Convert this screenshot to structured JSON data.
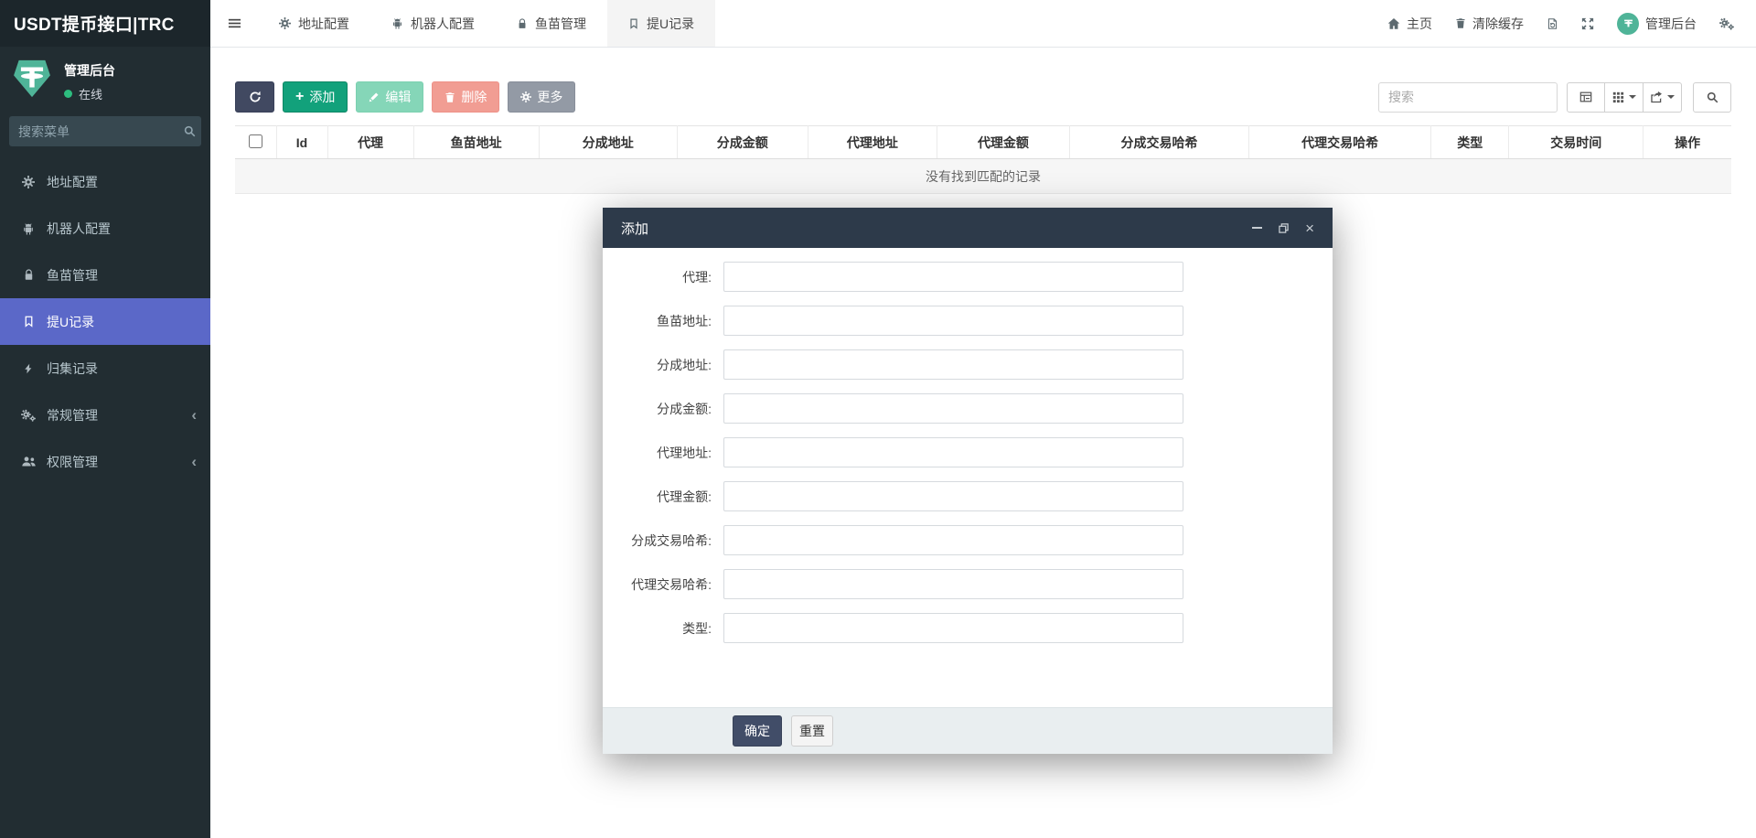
{
  "app": {
    "title": "USDT提币接口|TRC"
  },
  "colors": {
    "sidebar_bg": "#222d32",
    "active_item_blue": "#5b68c8",
    "tether_green": "#4fb498",
    "add_button_green": "#12a17b",
    "edit_button_green": "#85d6b8",
    "delete_button_red": "#f19d93",
    "more_button_gray": "#939aa5",
    "dark_button": "#414961",
    "modal_header_bg": "#2d3a4a",
    "ok_button": "#414d68",
    "online_dot": "#2dbd7f"
  },
  "sidebar": {
    "user": {
      "name": "管理后台",
      "status": "在线"
    },
    "search_placeholder": "搜索菜单",
    "items": [
      {
        "label": "地址配置",
        "icon": "gear-icon"
      },
      {
        "label": "机器人配置",
        "icon": "robot-icon"
      },
      {
        "label": "鱼苗管理",
        "icon": "lock-icon"
      },
      {
        "label": "提U记录",
        "icon": "bookmark-icon",
        "active": true
      },
      {
        "label": "归集记录",
        "icon": "bolt-icon"
      },
      {
        "label": "常规管理",
        "icon": "cogs-icon",
        "expandable": true
      },
      {
        "label": "权限管理",
        "icon": "users-icon",
        "expandable": true
      }
    ]
  },
  "navbar": {
    "tabs": [
      {
        "label": "地址配置",
        "icon": "gear-icon"
      },
      {
        "label": "机器人配置",
        "icon": "robot-icon"
      },
      {
        "label": "鱼苗管理",
        "icon": "lock-icon"
      },
      {
        "label": "提U记录",
        "icon": "bookmark-icon",
        "active": true
      }
    ],
    "home_label": "主页",
    "clear_cache_label": "清除缓存",
    "user_label": "管理后台"
  },
  "toolbar": {
    "add_label": "添加",
    "edit_label": "编辑",
    "delete_label": "删除",
    "more_label": "更多",
    "search_placeholder": "搜索"
  },
  "table": {
    "columns": [
      "Id",
      "代理",
      "鱼苗地址",
      "分成地址",
      "分成金额",
      "代理地址",
      "代理金额",
      "分成交易哈希",
      "代理交易哈希",
      "类型",
      "交易时间",
      "操作"
    ],
    "empty_text": "没有找到匹配的记录"
  },
  "modal": {
    "title": "添加",
    "fields": [
      {
        "label": "代理:"
      },
      {
        "label": "鱼苗地址:"
      },
      {
        "label": "分成地址:"
      },
      {
        "label": "分成金额:"
      },
      {
        "label": "代理地址:"
      },
      {
        "label": "代理金额:"
      },
      {
        "label": "分成交易哈希:"
      },
      {
        "label": "代理交易哈希:"
      },
      {
        "label": "类型:"
      }
    ],
    "ok_label": "确定",
    "reset_label": "重置"
  }
}
